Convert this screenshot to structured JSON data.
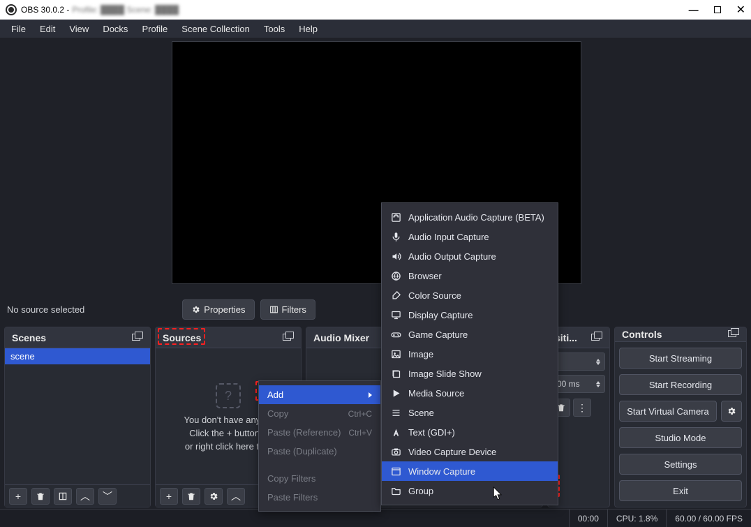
{
  "title": {
    "app": "OBS 30.0.2 -",
    "obscured": "Profile: ████   Scene: ████"
  },
  "menubar": [
    "File",
    "Edit",
    "View",
    "Docks",
    "Profile",
    "Scene Collection",
    "Tools",
    "Help"
  ],
  "underpreview": {
    "status": "No source selected",
    "properties": "Properties",
    "filters": "Filters"
  },
  "docks": {
    "scenes": {
      "title": "Scenes",
      "selected": "scene"
    },
    "sources": {
      "title": "Sources",
      "empty1": "You don't have any so",
      "empty2": "Click the + button b",
      "empty3": "or right click here to a"
    },
    "mixer": {
      "title": "Audio Mixer"
    },
    "transitions": {
      "title": "siti...",
      "duration": "00 ms"
    },
    "controls": {
      "title": "Controls",
      "start_streaming": "Start Streaming",
      "start_recording": "Start Recording",
      "start_virtual_camera": "Start Virtual Camera",
      "studio_mode": "Studio Mode",
      "settings": "Settings",
      "exit": "Exit"
    }
  },
  "statusbar": {
    "time": "00:00",
    "cpu": "CPU: 1.8%",
    "fps": "60.00 / 60.00 FPS"
  },
  "ctxmenu1": {
    "add": "Add",
    "copy": "Copy",
    "copy_hk": "Ctrl+C",
    "paste_ref": "Paste (Reference)",
    "paste_ref_hk": "Ctrl+V",
    "paste_dup": "Paste (Duplicate)",
    "copy_filters": "Copy Filters",
    "paste_filters": "Paste Filters"
  },
  "ctxmenu2": [
    {
      "icon": "app-audio",
      "label": "Application Audio Capture (BETA)"
    },
    {
      "icon": "mic",
      "label": "Audio Input Capture"
    },
    {
      "icon": "speaker",
      "label": "Audio Output Capture"
    },
    {
      "icon": "globe",
      "label": "Browser"
    },
    {
      "icon": "brush",
      "label": "Color Source"
    },
    {
      "icon": "display",
      "label": "Display Capture"
    },
    {
      "icon": "gamepad",
      "label": "Game Capture"
    },
    {
      "icon": "image",
      "label": "Image"
    },
    {
      "icon": "slides",
      "label": "Image Slide Show"
    },
    {
      "icon": "play",
      "label": "Media Source"
    },
    {
      "icon": "list",
      "label": "Scene"
    },
    {
      "icon": "text",
      "label": "Text (GDI+)"
    },
    {
      "icon": "camera",
      "label": "Video Capture Device"
    },
    {
      "icon": "window",
      "label": "Window Capture"
    },
    {
      "icon": "folder",
      "label": "Group"
    }
  ]
}
